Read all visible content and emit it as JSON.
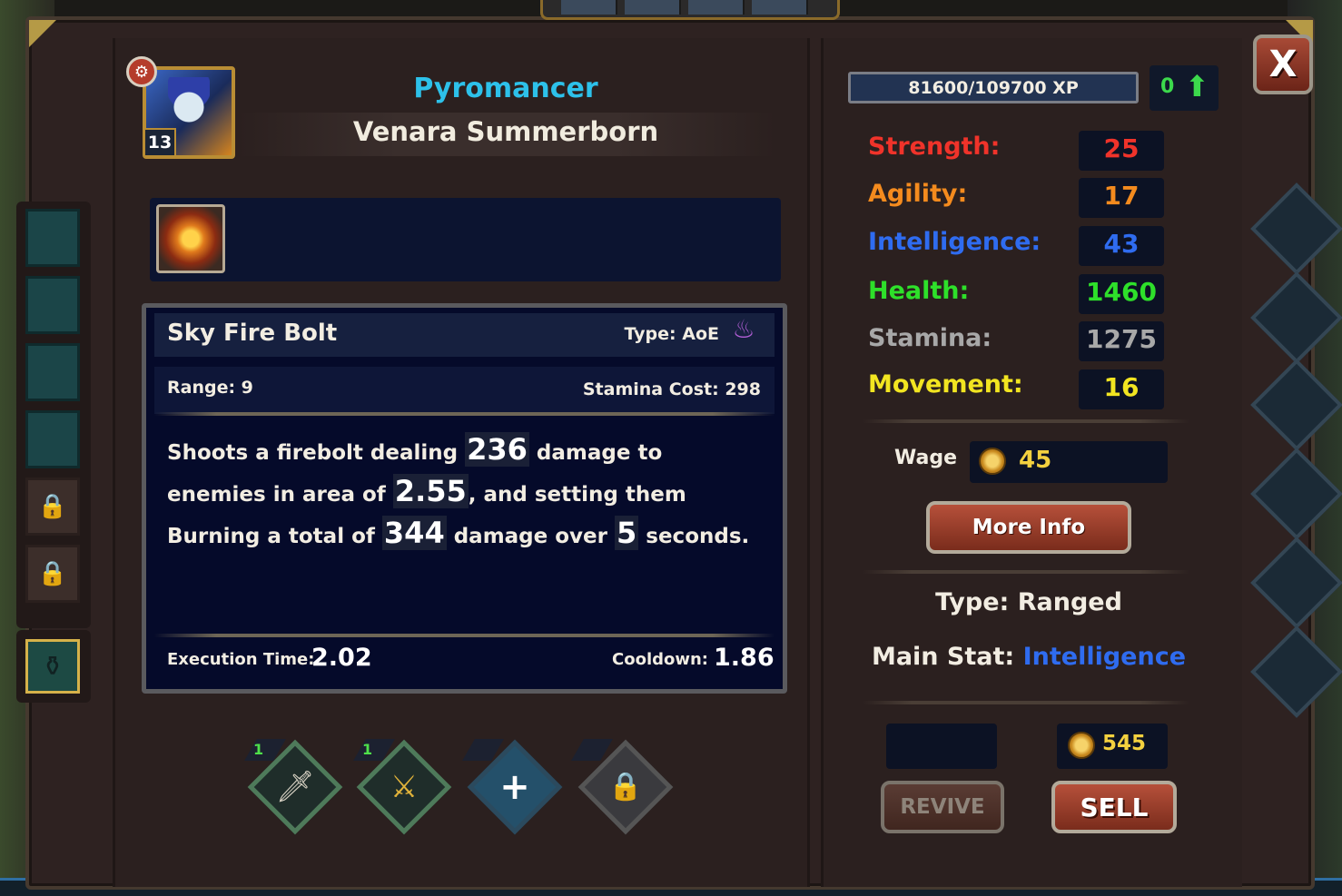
{
  "hero": {
    "class": "Pyromancer",
    "name": "Venara Summerborn",
    "level": "13"
  },
  "ability": {
    "name": "Sky Fire Bolt",
    "type": "Type: AoE",
    "range": "Range: 9",
    "stamina_cost": "Stamina Cost: 298",
    "desc": {
      "p1": "Shoots a firebolt dealing ",
      "n1": "236",
      "p2": " damage to enemies in area of ",
      "n2": "2.55",
      "p3": ", and setting them Burning a total of ",
      "n3": "344",
      "p4": " damage over ",
      "n4": "5",
      "p5": " seconds."
    },
    "execution_label": "Execution Time:",
    "execution_value": "2.02",
    "cooldown_label": "Cooldown:",
    "cooldown_value": "1.86"
  },
  "ability_slots": [
    {
      "count": "1",
      "icon": "sword-icon"
    },
    {
      "count": "1",
      "icon": "hero-icon"
    },
    {
      "count": "",
      "icon": "plus-icon"
    },
    {
      "count": "",
      "icon": "lock-icon"
    }
  ],
  "xp": {
    "text": "81600/109700 XP",
    "upgrade_points": "0"
  },
  "stats": [
    {
      "label": "Strength:",
      "value": "25",
      "color": "#f0332a"
    },
    {
      "label": "Agility:",
      "value": "17",
      "color": "#f48b1e"
    },
    {
      "label": "Intelligence:",
      "value": "43",
      "color": "#2f6cf0"
    },
    {
      "label": "Health:",
      "value": "1460",
      "color": "#2ee02a"
    },
    {
      "label": "Stamina:",
      "value": "1275",
      "color": "#a8a8a8"
    },
    {
      "label": "Movement:",
      "value": "16",
      "color": "#f2e521"
    }
  ],
  "wage": {
    "label": "Wage",
    "value": "45"
  },
  "buttons": {
    "more_info": "More Info",
    "close": "X",
    "revive": "REVIVE",
    "sell": "SELL"
  },
  "info": {
    "type_line": "Type: Ranged",
    "main_stat_label": "Main Stat: ",
    "main_stat_value": "Intelligence"
  },
  "sell_price": "545"
}
